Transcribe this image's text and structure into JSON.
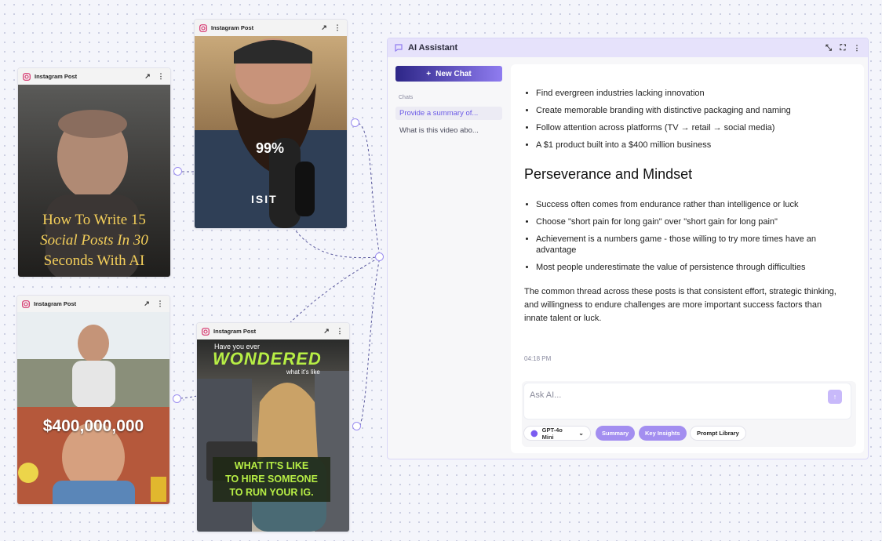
{
  "posts": [
    {
      "label": "Instagram Post",
      "caption_lines": [
        "How To Write 15",
        "Social Posts In 30",
        "Seconds With AI"
      ]
    },
    {
      "label": "Instagram Post",
      "caption": "99%",
      "shirt_text": "ISIT"
    },
    {
      "label": "Instagram Post",
      "caption": "$400,000,000"
    },
    {
      "label": "Instagram Post",
      "caption_small_top": "Have you ever",
      "caption_big": "WONDERED",
      "caption_small": "what it's like",
      "caption_box_lines": [
        "WHAT IT'S LIKE",
        "TO HIRE SOMEONE",
        "TO RUN YOUR IG."
      ]
    }
  ],
  "assistant": {
    "title": "AI Assistant",
    "new_chat": "New Chat",
    "chats_label": "Chats",
    "chats": [
      "Provide a summary of...",
      "What is this video abo..."
    ],
    "bullets_top": [
      "Find evergreen industries lacking innovation",
      "Create memorable branding with distinctive packaging and naming",
      "Follow attention across platforms (TV → retail → social media)",
      "A $1 product built into a $400 million business"
    ],
    "heading": "Perseverance and Mindset",
    "bullets_bottom": [
      "Success often comes from endurance rather than intelligence or luck",
      "Choose \"short pain for long gain\" over \"short gain for long pain\"",
      "Achievement is a numbers game - those willing to try more times have an advantage",
      "Most people underestimate the value of persistence through difficulties"
    ],
    "conclusion": "The common thread across these posts is that consistent effort, strategic thinking, and willingness to endure challenges are more important success factors than innate talent or luck.",
    "timestamp": "04:18 PM",
    "input_placeholder": "Ask AI...",
    "model": "GPT-4o Mini",
    "pills": [
      "Summary",
      "Key Insights",
      "Prompt Library"
    ]
  },
  "colors": {
    "accent": "#8f7cf0",
    "accent_dark": "#2d2687",
    "connector": "#5b5a9e"
  }
}
